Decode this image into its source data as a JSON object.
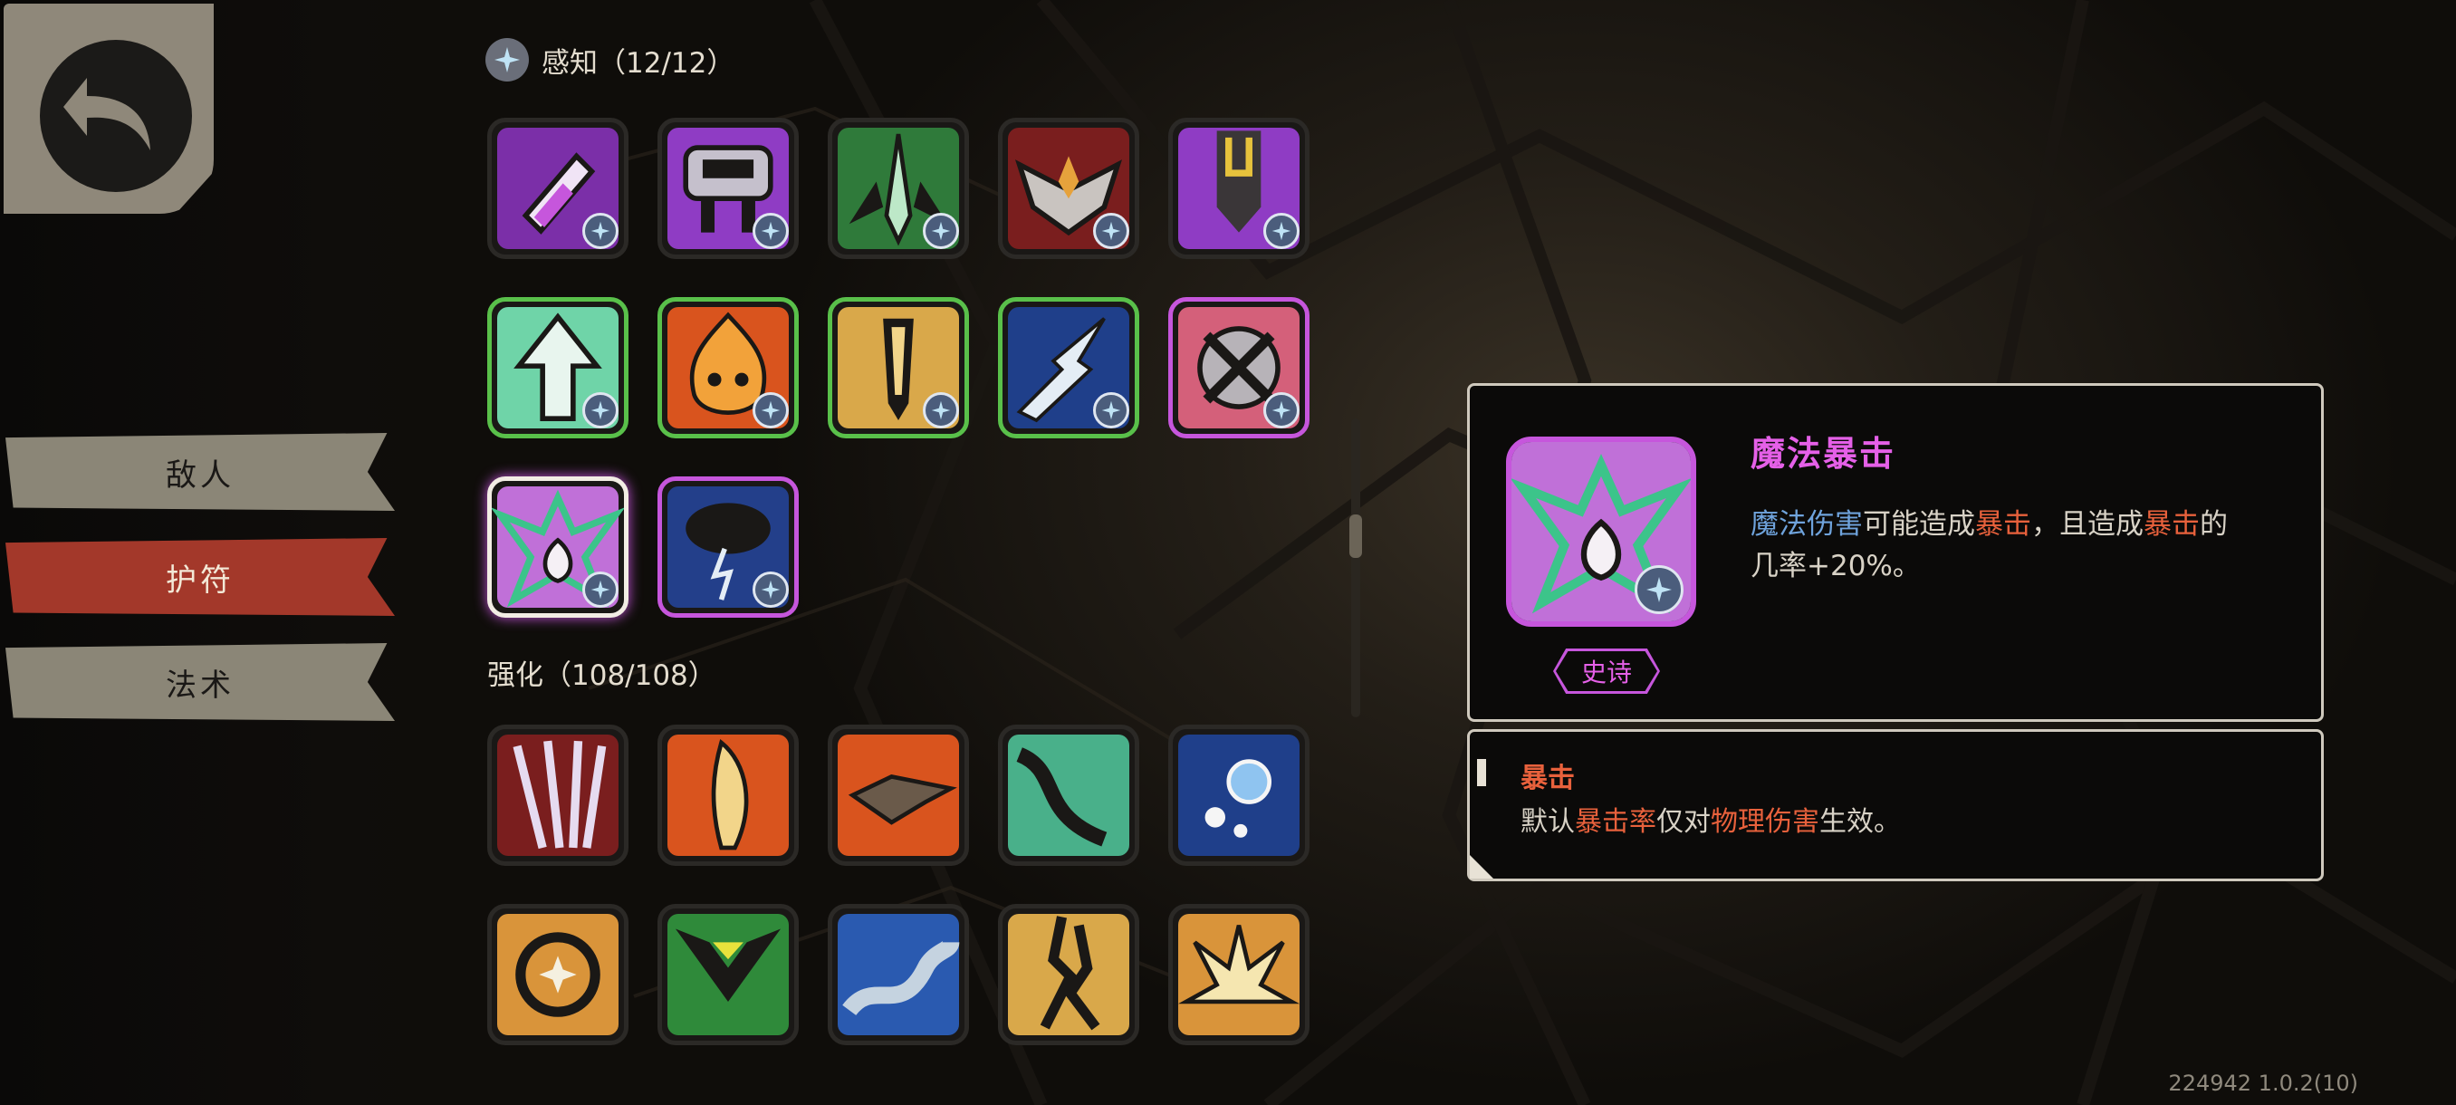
{
  "nav": {
    "back_label": "返回",
    "tabs": [
      {
        "label": "敌人",
        "active": false
      },
      {
        "label": "护符",
        "active": true
      },
      {
        "label": "法术",
        "active": false
      }
    ]
  },
  "sections": {
    "perception": {
      "title": "感知（12/12）"
    },
    "enhance": {
      "title": "强化（108/108）"
    }
  },
  "detail": {
    "title": "魔法暴击",
    "desc_parts": {
      "p1": "魔法伤害",
      "p2": "可能造成",
      "p3": "暴击",
      "p4": "，且造成",
      "p5": "暴击",
      "p6": "的",
      "p7": "几率+20%。"
    },
    "rarity": "史诗"
  },
  "note": {
    "title": "暴击",
    "parts": {
      "n1": "默认",
      "n2": "暴击率",
      "n3": "仅对",
      "n4": "物理伤害",
      "n5": "生效。"
    }
  },
  "version": "224942 1.0.2(10)",
  "colors": {
    "accent_red": "#a3382a",
    "epic_purple": "#c656dc",
    "rare_green": "#59c04a",
    "keyword_blue": "#6fa3dc",
    "keyword_red": "#e8613c"
  }
}
